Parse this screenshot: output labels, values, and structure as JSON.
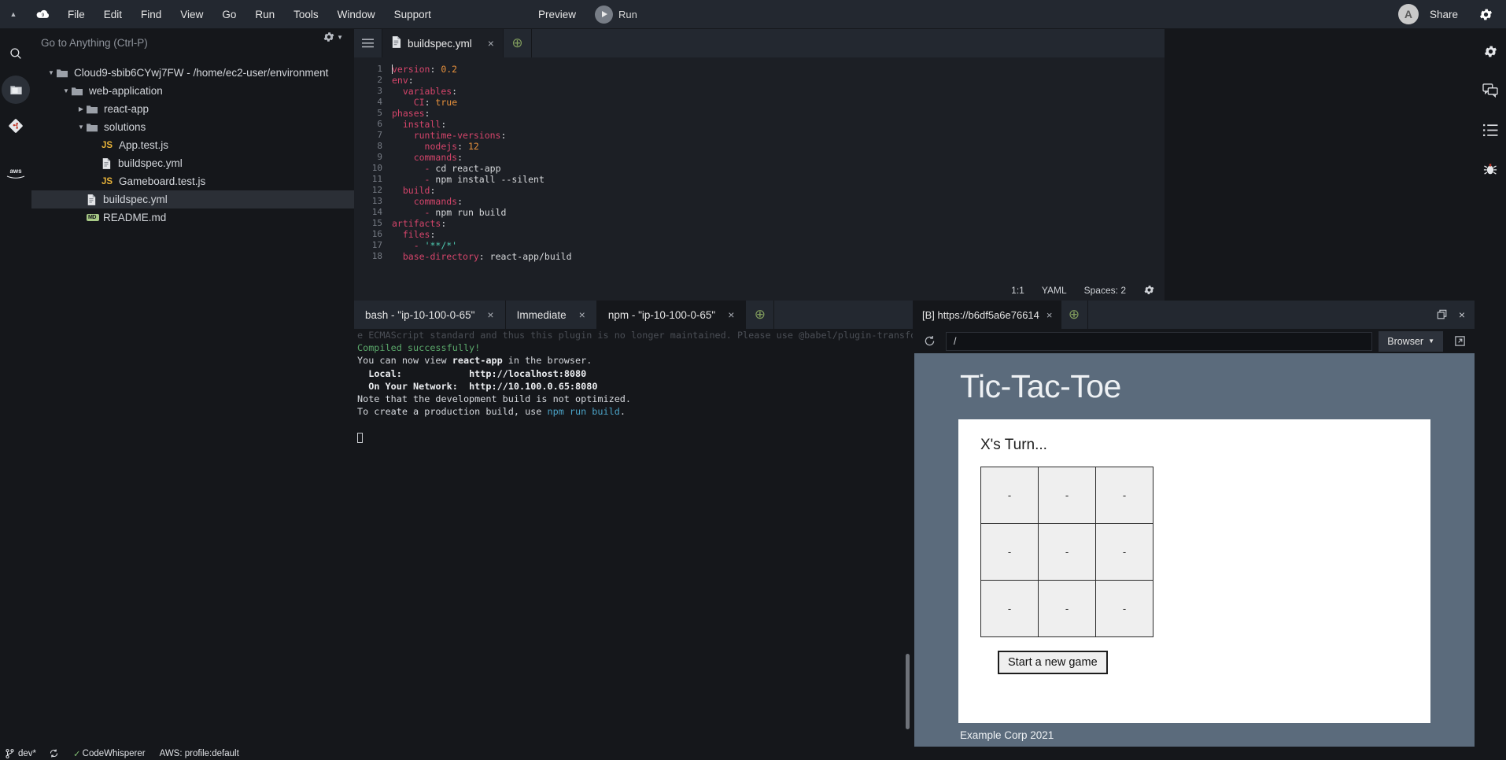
{
  "menubar": {
    "caret_icon": "triangle-up-icon",
    "cloud_icon": "cloud9-logo-icon",
    "items": [
      "File",
      "Edit",
      "Find",
      "View",
      "Go",
      "Run",
      "Tools",
      "Window",
      "Support"
    ],
    "preview_label": "Preview",
    "run_label": "Run",
    "avatar_initial": "A",
    "share_label": "Share",
    "settings_icon": "gear-icon"
  },
  "left_rail": {
    "items": [
      {
        "name": "search-icon",
        "label": "Search"
      },
      {
        "name": "folder-icon",
        "label": "Environment",
        "active": true
      },
      {
        "name": "git-icon",
        "label": "Source Control"
      },
      {
        "name": "aws-logo-icon",
        "label": "AWS"
      }
    ]
  },
  "search": {
    "placeholder": "Go to Anything (Ctrl-P)",
    "icon": "search-icon"
  },
  "tree": {
    "gear_icon": "gear-icon",
    "root": "Cloud9-sbib6CYwj7FW - /home/ec2-user/environment",
    "items": [
      {
        "label": "Cloud9-sbib6CYwj7FW - /home/ec2-user/environment",
        "type": "folder",
        "depth": 0,
        "expanded": true,
        "selected": false
      },
      {
        "label": "web-application",
        "type": "folder",
        "depth": 1,
        "expanded": true,
        "selected": false
      },
      {
        "label": "react-app",
        "type": "folder",
        "depth": 2,
        "expanded": false,
        "selected": false
      },
      {
        "label": "solutions",
        "type": "folder",
        "depth": 2,
        "expanded": true,
        "selected": false
      },
      {
        "label": "App.test.js",
        "type": "js",
        "depth": 3,
        "selected": false
      },
      {
        "label": "buildspec.yml",
        "type": "yml",
        "depth": 3,
        "selected": false
      },
      {
        "label": "Gameboard.test.js",
        "type": "js",
        "depth": 3,
        "selected": false
      },
      {
        "label": "buildspec.yml",
        "type": "yml",
        "depth": 2,
        "selected": true
      },
      {
        "label": "README.md",
        "type": "md",
        "depth": 2,
        "selected": false
      }
    ]
  },
  "editor": {
    "hamburger_icon": "menu-icon",
    "tab": {
      "label": "buildspec.yml",
      "icon": "file-icon",
      "close": "×"
    },
    "new_tab_icon": "plus-circle-icon",
    "status": {
      "position": "1:1",
      "language": "YAML",
      "spaces": "Spaces: 2",
      "gear_icon": "gear-icon"
    },
    "lines": [
      {
        "n": "1",
        "tokens": [
          {
            "t": "caret"
          },
          {
            "t": "key",
            "v": "version"
          },
          {
            "t": "plain",
            "v": ": "
          },
          {
            "t": "num",
            "v": "0.2"
          }
        ]
      },
      {
        "n": "2",
        "tokens": [
          {
            "t": "key",
            "v": "env"
          },
          {
            "t": "plain",
            "v": ":"
          }
        ]
      },
      {
        "n": "3",
        "tokens": [
          {
            "t": "plain",
            "v": "  "
          },
          {
            "t": "key",
            "v": "variables"
          },
          {
            "t": "plain",
            "v": ":"
          }
        ]
      },
      {
        "n": "4",
        "tokens": [
          {
            "t": "plain",
            "v": "    "
          },
          {
            "t": "key",
            "v": "CI"
          },
          {
            "t": "plain",
            "v": ": "
          },
          {
            "t": "bool",
            "v": "true"
          }
        ]
      },
      {
        "n": "5",
        "tokens": [
          {
            "t": "key",
            "v": "phases"
          },
          {
            "t": "plain",
            "v": ":"
          }
        ]
      },
      {
        "n": "6",
        "tokens": [
          {
            "t": "plain",
            "v": "  "
          },
          {
            "t": "key",
            "v": "install"
          },
          {
            "t": "plain",
            "v": ":"
          }
        ]
      },
      {
        "n": "7",
        "tokens": [
          {
            "t": "plain",
            "v": "    "
          },
          {
            "t": "key",
            "v": "runtime-versions"
          },
          {
            "t": "plain",
            "v": ":"
          }
        ]
      },
      {
        "n": "8",
        "tokens": [
          {
            "t": "plain",
            "v": "      "
          },
          {
            "t": "key",
            "v": "nodejs"
          },
          {
            "t": "plain",
            "v": ": "
          },
          {
            "t": "num",
            "v": "12"
          }
        ]
      },
      {
        "n": "9",
        "tokens": [
          {
            "t": "plain",
            "v": "    "
          },
          {
            "t": "key",
            "v": "commands"
          },
          {
            "t": "plain",
            "v": ":"
          }
        ]
      },
      {
        "n": "10",
        "tokens": [
          {
            "t": "plain",
            "v": "      "
          },
          {
            "t": "dash",
            "v": "- "
          },
          {
            "t": "val",
            "v": "cd react-app"
          }
        ]
      },
      {
        "n": "11",
        "tokens": [
          {
            "t": "plain",
            "v": "      "
          },
          {
            "t": "dash",
            "v": "- "
          },
          {
            "t": "val",
            "v": "npm install --silent"
          }
        ]
      },
      {
        "n": "12",
        "tokens": [
          {
            "t": "plain",
            "v": "  "
          },
          {
            "t": "key",
            "v": "build"
          },
          {
            "t": "plain",
            "v": ":"
          }
        ]
      },
      {
        "n": "13",
        "tokens": [
          {
            "t": "plain",
            "v": "    "
          },
          {
            "t": "key",
            "v": "commands"
          },
          {
            "t": "plain",
            "v": ":"
          }
        ]
      },
      {
        "n": "14",
        "tokens": [
          {
            "t": "plain",
            "v": "      "
          },
          {
            "t": "dash",
            "v": "- "
          },
          {
            "t": "val",
            "v": "npm run build"
          }
        ]
      },
      {
        "n": "15",
        "tokens": [
          {
            "t": "key",
            "v": "artifacts"
          },
          {
            "t": "plain",
            "v": ":"
          }
        ]
      },
      {
        "n": "16",
        "tokens": [
          {
            "t": "plain",
            "v": "  "
          },
          {
            "t": "key",
            "v": "files"
          },
          {
            "t": "plain",
            "v": ":"
          }
        ]
      },
      {
        "n": "17",
        "tokens": [
          {
            "t": "plain",
            "v": "    "
          },
          {
            "t": "dash",
            "v": "- "
          },
          {
            "t": "str",
            "v": "'**/*'"
          }
        ]
      },
      {
        "n": "18",
        "tokens": [
          {
            "t": "plain",
            "v": "  "
          },
          {
            "t": "key",
            "v": "base-directory"
          },
          {
            "t": "plain",
            "v": ": "
          },
          {
            "t": "val",
            "v": "react-app/build"
          }
        ]
      }
    ]
  },
  "terminal": {
    "tabs": [
      {
        "label": "bash - \"ip-10-100-0-65\"",
        "active": false,
        "close": "×"
      },
      {
        "label": "Immediate",
        "active": false,
        "close": "×"
      },
      {
        "label": "npm - \"ip-10-100-0-65\"",
        "active": true,
        "close": "×"
      }
    ],
    "new_tab_icon": "plus-circle-icon",
    "lines": [
      {
        "cls": "t-clip",
        "text": "e ECMAScript standard and thus this plugin is no longer maintained. Please use @babel/plugin-transform"
      },
      {
        "cls": "t-green",
        "text": "Compiled successfully!"
      },
      {
        "cls": "",
        "text": ""
      },
      {
        "cls": "",
        "text": "You can now view react-app in the browser."
      },
      {
        "cls": "",
        "text": ""
      },
      {
        "cls": "",
        "text": "  Local:            http://localhost:8080"
      },
      {
        "cls": "",
        "text": "  On Your Network:  http://10.100.0.65:8080"
      },
      {
        "cls": "",
        "text": ""
      },
      {
        "cls": "",
        "text": "Note that the development build is not optimized."
      },
      {
        "cls": "",
        "text": "To create a production build, use npm run build."
      }
    ]
  },
  "preview": {
    "tab": {
      "label": "[B] https://b6df5a6e76614",
      "close": "×"
    },
    "new_tab_icon": "plus-circle-icon",
    "restore_icon": "restore-window-icon",
    "close_icon": "close-icon",
    "reload_icon": "reload-icon",
    "url": "/",
    "browser_label": "Browser",
    "chevron_icon": "chevron-down-icon",
    "popout_icon": "pop-out-icon",
    "page": {
      "title": "Tic-Tac-Toe",
      "turn": "X's Turn...",
      "board": [
        [
          "-",
          "-",
          "-"
        ],
        [
          "-",
          "-",
          "-"
        ],
        [
          "-",
          "-",
          "-"
        ]
      ],
      "new_game_label": "Start a new game",
      "footer": "Example Corp 2021",
      "header_color": "#5b6b7c",
      "cell_color": "#efefef"
    }
  },
  "right_rail": {
    "items": [
      {
        "name": "gear-icon",
        "label": "Preferences"
      },
      {
        "name": "comments-icon",
        "label": "Collaborate"
      },
      {
        "name": "outline-list-icon",
        "label": "Outline"
      },
      {
        "name": "debugger-icon",
        "label": "Debugger"
      }
    ]
  },
  "statusbar": {
    "branch_icon": "git-branch-icon",
    "branch": "dev*",
    "sync_icon": "sync-icon",
    "check_icon": "check-icon",
    "codewhisperer": "CodeWhisperer",
    "aws_profile": "AWS: profile:default"
  }
}
